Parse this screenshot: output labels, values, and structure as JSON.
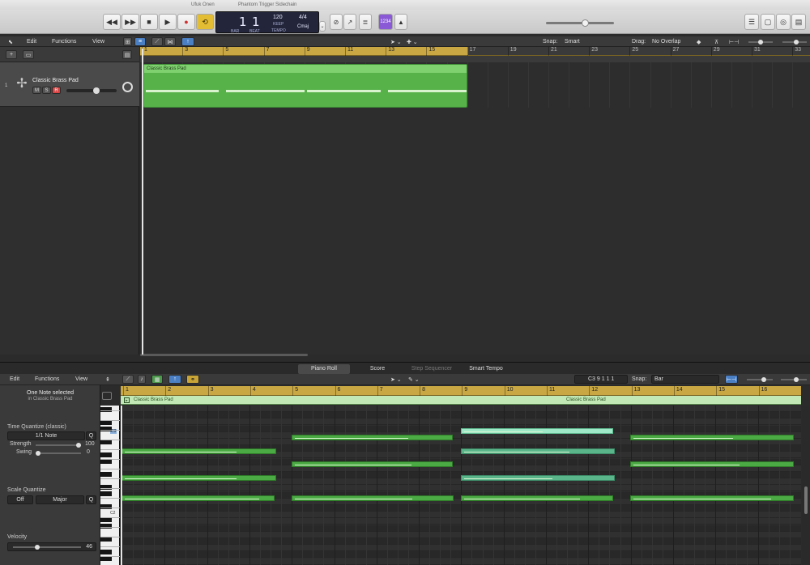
{
  "window": {
    "user": "Ufuk Onen",
    "project": "Phantom Trigger Sidechain"
  },
  "control_bar": {
    "lcd": {
      "bar": "1",
      "beat": "1",
      "tempo": "120",
      "tempo_label": "KEEP",
      "signature": "4/4",
      "key": "Cmaj",
      "bar_label": "BAR",
      "beat_label": "BEAT",
      "tempo_sub": "TEMPO"
    },
    "count_in": "1234",
    "icons": [
      "rewind-icon",
      "fast-forward-icon",
      "stop-icon",
      "play-icon",
      "record-icon",
      "cycle-icon"
    ]
  },
  "main_menu": {
    "edit": "Edit",
    "functions": "Functions",
    "view": "View",
    "snap_label": "Snap:",
    "snap_value": "Smart",
    "drag_label": "Drag:",
    "drag_value": "No Overlap"
  },
  "ruler_top": [
    "1",
    "3",
    "5",
    "7",
    "9",
    "11",
    "13",
    "15",
    "17",
    "19",
    "21",
    "23",
    "25",
    "27",
    "29",
    "31",
    "33"
  ],
  "track": {
    "number": "1",
    "name": "Classic Brass Pad",
    "mute": "M",
    "solo": "S",
    "record": "R",
    "region_name": "Classic Brass Pad",
    "volume": 0.6
  },
  "tabs": {
    "piano_roll": "Piano Roll",
    "score": "Score",
    "step_sequencer": "Step Sequencer",
    "smart_tempo": "Smart Tempo"
  },
  "editor_menu": {
    "edit": "Edit",
    "functions": "Functions",
    "view": "View",
    "position": "C3   9 1 1 1",
    "snap_label": "Snap:",
    "snap_value": "Bar"
  },
  "ruler_bottom": [
    "1",
    "2",
    "3",
    "4",
    "5",
    "6",
    "7",
    "8",
    "9",
    "10",
    "11",
    "12",
    "13",
    "14",
    "15",
    "16"
  ],
  "region_bar": {
    "left": "Classic Brass Pad",
    "right": "Classic Brass Pad"
  },
  "inspector": {
    "selection": "One Note selected",
    "selection_sub": "in Classic Brass Pad",
    "time_quantize_label": "Time Quantize (classic)",
    "time_quantize_value": "1/1 Note",
    "q": "Q",
    "strength_label": "Strength",
    "strength_value": "100",
    "swing_label": "Swing",
    "swing_value": "0",
    "scale_quantize_label": "Scale Quantize",
    "scale_off": "Off",
    "scale_mode": "Major",
    "velocity_label": "Velocity",
    "velocity_value": "46"
  },
  "keyboard_labels": {
    "c3": "C3",
    "c2": "C2"
  }
}
